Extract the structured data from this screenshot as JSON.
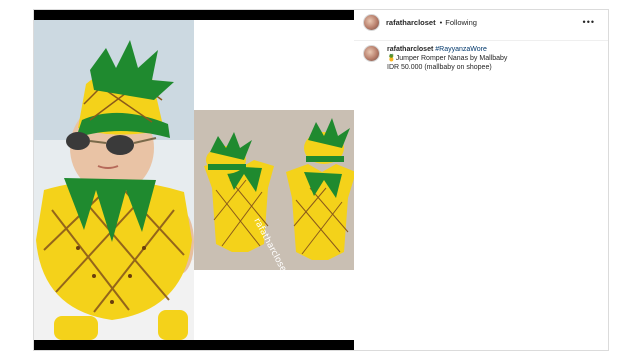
{
  "post": {
    "username": "rafatharcloset",
    "separator": "•",
    "follow_status": "Following",
    "more_label": "•••",
    "caption": {
      "username": "rafatharcloset",
      "hashtag": "#RayyanzaWore",
      "line2": "🍍Jumper Romper Nanas by Mallbaby",
      "line3": "IDR 50.000 (mallbaby on shopee)"
    },
    "image": {
      "watermark": "rafatharcloset"
    }
  },
  "colors": {
    "romper_yellow": "#f4d21a",
    "leaf_green": "#1f8a2f",
    "rug_beige": "#c9bfb3"
  }
}
